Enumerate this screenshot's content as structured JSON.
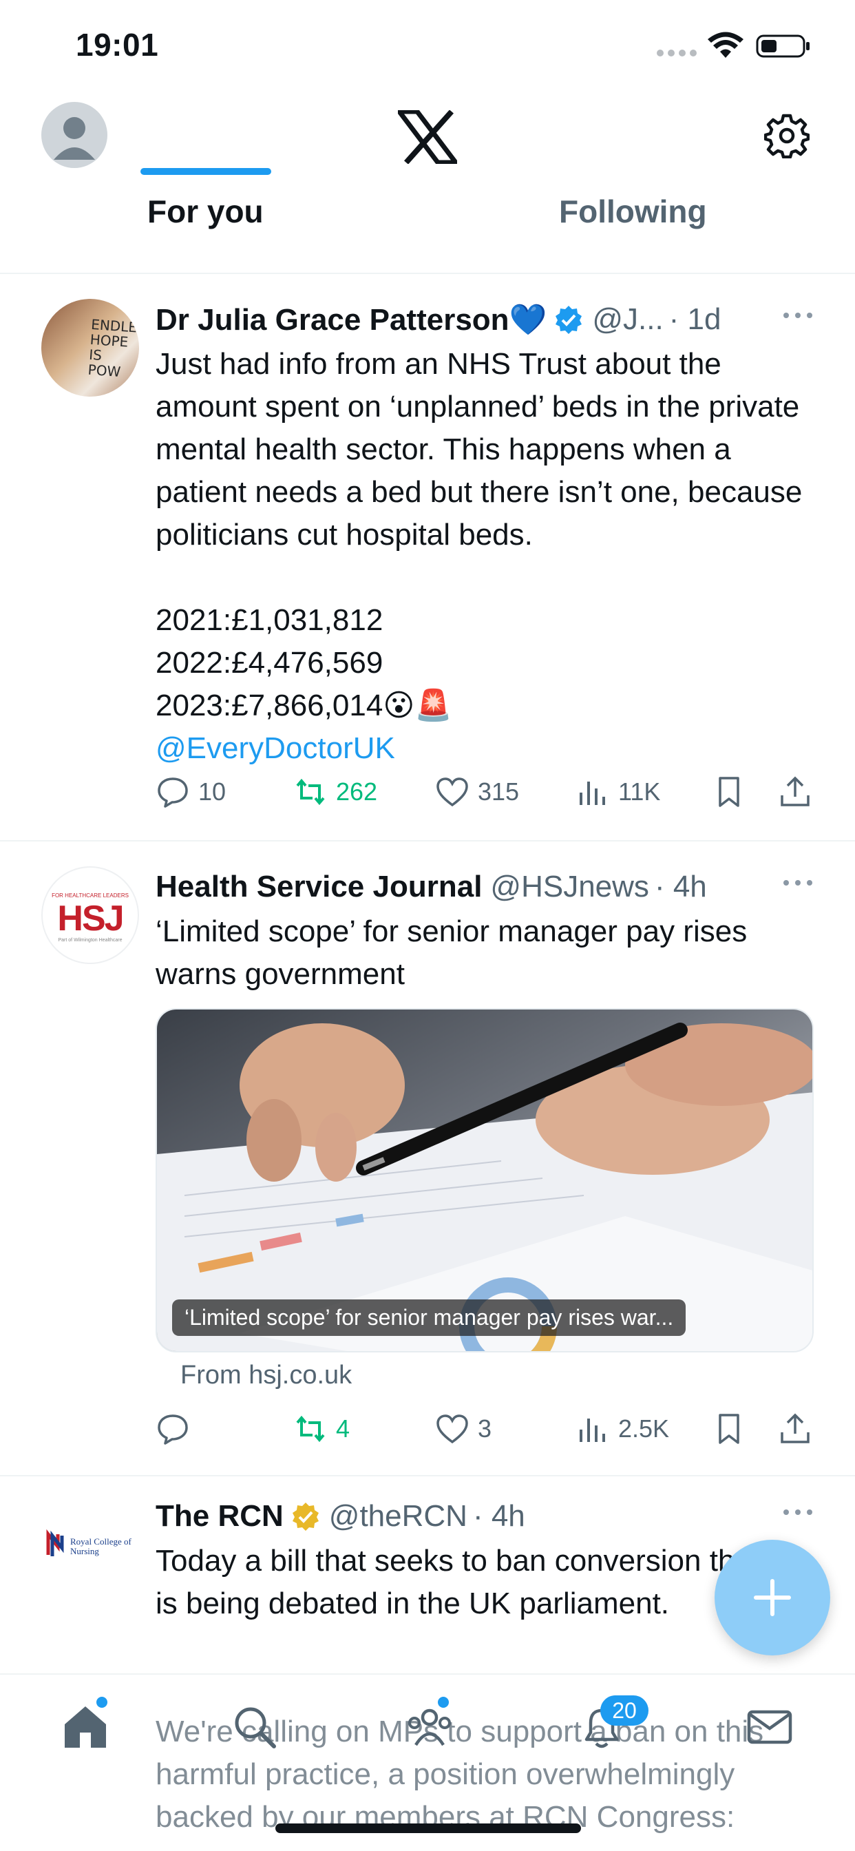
{
  "status_bar": {
    "time": "19:01"
  },
  "header": {
    "tabs": [
      {
        "label": "For you"
      },
      {
        "label": "Following"
      }
    ]
  },
  "tweets": [
    {
      "name": "Dr Julia Grace Patterson💙",
      "handle": "@J...",
      "time": "· 1d",
      "text": "Just had info from an NHS Trust about the amount spent on ‘unplanned’ beds in the private mental health sector. This happens when a patient needs a bed but there isn’t one, because politicians cut hospital beds.\n\n2021:£1,031,812\n2022:£4,476,569\n2023:£7,866,014😮🚨",
      "mention": "@EveryDoctorUK",
      "avatar_text": "ENDLESS HOPE IS POW",
      "replies": "10",
      "retweets": "262",
      "likes": "315",
      "views": "11K"
    },
    {
      "name": "Health Service Journal",
      "handle": "@HSJnews",
      "time": "· 4h",
      "text": "‘Limited scope’ for senior manager pay rises warns government",
      "avatar_logo": "HSJ",
      "avatar_top": "FOR HEALTHCARE LEADERS",
      "avatar_bottom": "Part of Wilmington Healthcare",
      "card_caption": "‘Limited scope’ for senior manager pay rises war...",
      "card_source": "From hsj.co.uk",
      "replies": "",
      "retweets": "4",
      "likes": "3",
      "views": "2.5K"
    },
    {
      "name": "The RCN",
      "handle": "@theRCN",
      "time": "· 4h",
      "text": "Today a bill that seeks to ban conversion therapy is being debated in the UK parliament.",
      "avatar_text": "Royal College of Nursing",
      "faded_text": "We're calling on MPs to support a ban on this harmful practice, a position overwhelmingly backed by our members at RCN Congress:"
    }
  ],
  "bottom_nav": {
    "notifications_badge": "20"
  },
  "colors": {
    "accent": "#1d9bf0",
    "retweet_green": "#00ba7c",
    "verified_gold": "#e8b829"
  }
}
